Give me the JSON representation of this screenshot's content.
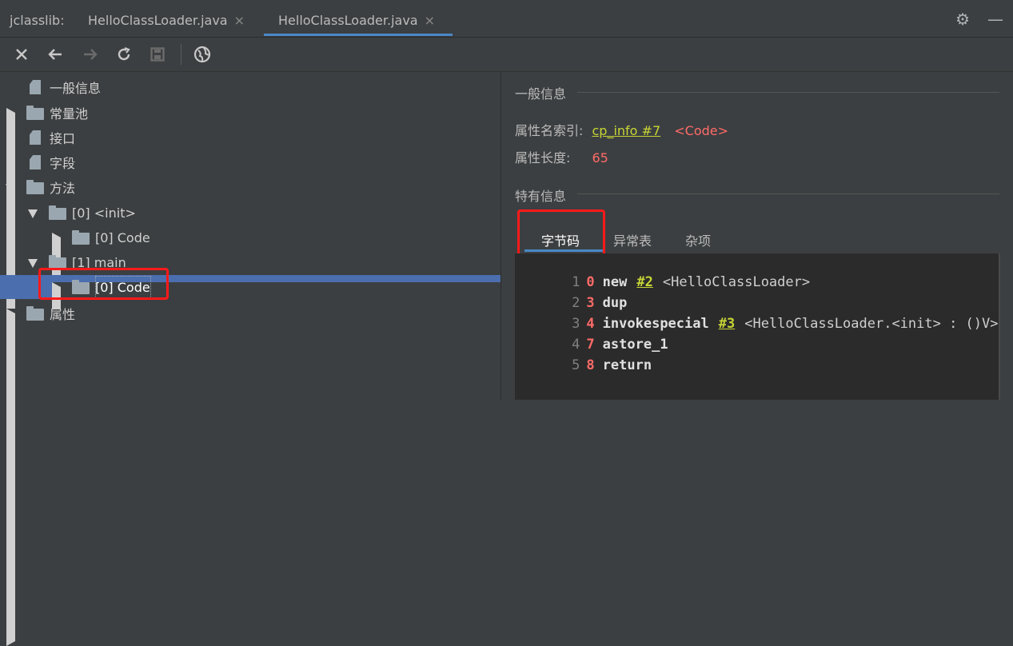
{
  "tabbar": {
    "tool_label": "jclasslib:",
    "tabs": [
      {
        "label": "HelloClassLoader.java",
        "close": "×"
      },
      {
        "label": "HelloClassLoader.java",
        "close": "×"
      }
    ]
  },
  "toolbar": {
    "icons": [
      "close-icon",
      "back-arrow-icon",
      "forward-arrow-icon",
      "refresh-icon",
      "save-icon",
      "globe-icon"
    ]
  },
  "tree": {
    "items": [
      {
        "label": "一般信息"
      },
      {
        "label": "常量池"
      },
      {
        "label": "接口"
      },
      {
        "label": "字段"
      },
      {
        "label": "方法"
      },
      {
        "label": "[0] <init>"
      },
      {
        "label": "[0] Code"
      },
      {
        "label": "[1] main"
      },
      {
        "label": "[0] Code"
      },
      {
        "label": "属性"
      }
    ]
  },
  "detail": {
    "general_title": "一般信息",
    "name_index_label": "属性名索引:",
    "name_index_link": "cp_info #7",
    "name_index_value": "<Code>",
    "length_label": "属性长度:",
    "length_value": "65",
    "specific_title": "特有信息",
    "subtabs": [
      "字节码",
      "异常表",
      "杂项"
    ],
    "code_lines": [
      {
        "num": "1",
        "pc": "0",
        "op": "new",
        "ref": "#2",
        "comment": "<HelloClassLoader>"
      },
      {
        "num": "2",
        "pc": "3",
        "op": "dup",
        "ref": "",
        "comment": ""
      },
      {
        "num": "3",
        "pc": "4",
        "op": "invokespecial",
        "ref": "#3",
        "comment": "<HelloClassLoader.<init> : ()V>"
      },
      {
        "num": "4",
        "pc": "7",
        "op": "astore_1",
        "ref": "",
        "comment": ""
      },
      {
        "num": "5",
        "pc": "8",
        "op": "return",
        "ref": "",
        "comment": ""
      }
    ]
  },
  "colors": {
    "selection": "#4b6eaf",
    "link": "#c7d535",
    "highlight_red": "#ff1a1a"
  }
}
